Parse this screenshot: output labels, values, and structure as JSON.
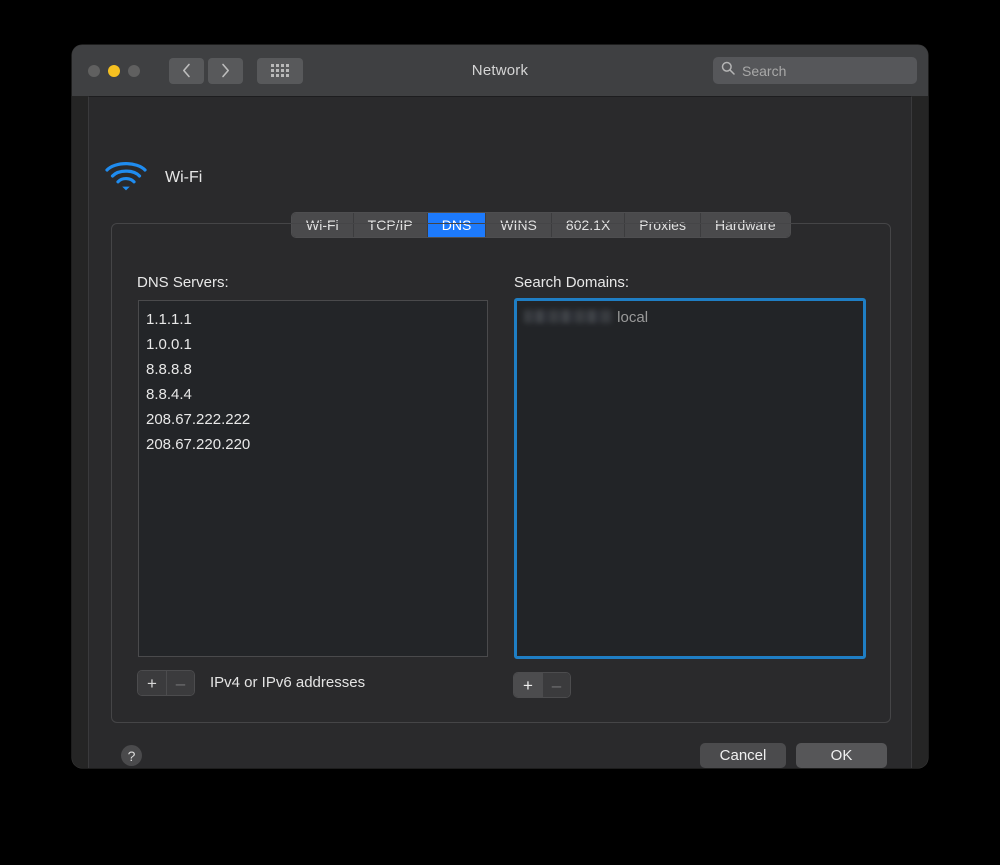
{
  "window": {
    "title": "Network",
    "traffic_lights": [
      {
        "name": "close",
        "color": "#606060",
        "state": "inactive"
      },
      {
        "name": "minimize",
        "color": "#f5c021",
        "state": "active"
      },
      {
        "name": "zoom",
        "color": "#606060",
        "state": "inactive"
      }
    ],
    "toolbar": {
      "back_icon": "chevron-left-icon",
      "forward_icon": "chevron-right-icon",
      "show_all_icon": "grid-icon"
    },
    "search": {
      "icon": "search-icon",
      "value": "",
      "placeholder": "Search"
    }
  },
  "service": {
    "icon": "wifi-icon",
    "icon_color": "#1f8cf0",
    "name": "Wi-Fi"
  },
  "tabs": [
    {
      "label": "Wi-Fi",
      "active": false
    },
    {
      "label": "TCP/IP",
      "active": false
    },
    {
      "label": "DNS",
      "active": true
    },
    {
      "label": "WINS",
      "active": false
    },
    {
      "label": "802.1X",
      "active": false
    },
    {
      "label": "Proxies",
      "active": false
    },
    {
      "label": "Hardware",
      "active": false
    }
  ],
  "accent_color": "#1d7afc",
  "focus_ring_color": "#1f7ec4",
  "dns_servers": {
    "label": "DNS Servers:",
    "entries": [
      "1.1.1.1",
      "1.0.0.1",
      "8.8.8.8",
      "8.8.4.4",
      "208.67.222.222",
      "208.67.220.220"
    ],
    "hint": "IPv4 or IPv6 addresses",
    "add_label": "+",
    "remove_label": "–",
    "remove_enabled": false
  },
  "search_domains": {
    "label": "Search Domains:",
    "focused": true,
    "entries": [
      {
        "redacted": true,
        "suffix": "local"
      }
    ],
    "add_label": "+",
    "remove_label": "–",
    "remove_enabled": false
  },
  "footer": {
    "help_label": "?",
    "cancel_label": "Cancel",
    "ok_label": "OK"
  }
}
